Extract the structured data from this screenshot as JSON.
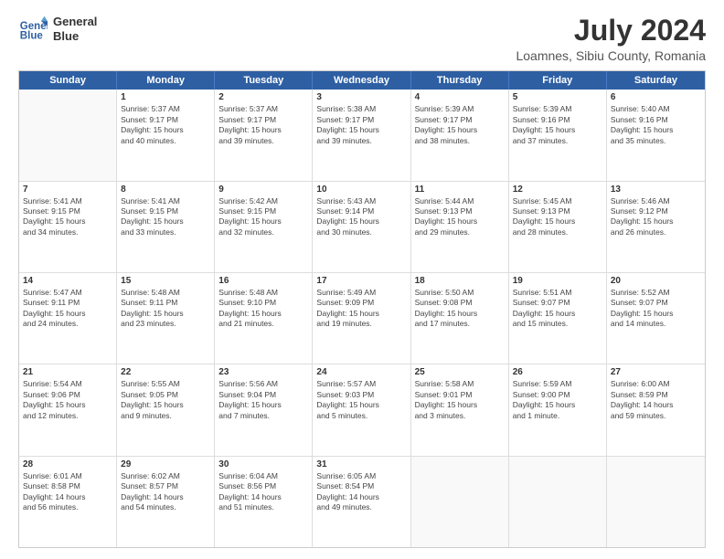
{
  "header": {
    "logo_line1": "General",
    "logo_line2": "Blue",
    "title": "July 2024",
    "subtitle": "Loamnes, Sibiu County, Romania"
  },
  "days_of_week": [
    "Sunday",
    "Monday",
    "Tuesday",
    "Wednesday",
    "Thursday",
    "Friday",
    "Saturday"
  ],
  "weeks": [
    [
      {
        "day": "",
        "lines": []
      },
      {
        "day": "1",
        "lines": [
          "Sunrise: 5:37 AM",
          "Sunset: 9:17 PM",
          "Daylight: 15 hours",
          "and 40 minutes."
        ]
      },
      {
        "day": "2",
        "lines": [
          "Sunrise: 5:37 AM",
          "Sunset: 9:17 PM",
          "Daylight: 15 hours",
          "and 39 minutes."
        ]
      },
      {
        "day": "3",
        "lines": [
          "Sunrise: 5:38 AM",
          "Sunset: 9:17 PM",
          "Daylight: 15 hours",
          "and 39 minutes."
        ]
      },
      {
        "day": "4",
        "lines": [
          "Sunrise: 5:39 AM",
          "Sunset: 9:17 PM",
          "Daylight: 15 hours",
          "and 38 minutes."
        ]
      },
      {
        "day": "5",
        "lines": [
          "Sunrise: 5:39 AM",
          "Sunset: 9:16 PM",
          "Daylight: 15 hours",
          "and 37 minutes."
        ]
      },
      {
        "day": "6",
        "lines": [
          "Sunrise: 5:40 AM",
          "Sunset: 9:16 PM",
          "Daylight: 15 hours",
          "and 35 minutes."
        ]
      }
    ],
    [
      {
        "day": "7",
        "lines": [
          "Sunrise: 5:41 AM",
          "Sunset: 9:15 PM",
          "Daylight: 15 hours",
          "and 34 minutes."
        ]
      },
      {
        "day": "8",
        "lines": [
          "Sunrise: 5:41 AM",
          "Sunset: 9:15 PM",
          "Daylight: 15 hours",
          "and 33 minutes."
        ]
      },
      {
        "day": "9",
        "lines": [
          "Sunrise: 5:42 AM",
          "Sunset: 9:15 PM",
          "Daylight: 15 hours",
          "and 32 minutes."
        ]
      },
      {
        "day": "10",
        "lines": [
          "Sunrise: 5:43 AM",
          "Sunset: 9:14 PM",
          "Daylight: 15 hours",
          "and 30 minutes."
        ]
      },
      {
        "day": "11",
        "lines": [
          "Sunrise: 5:44 AM",
          "Sunset: 9:13 PM",
          "Daylight: 15 hours",
          "and 29 minutes."
        ]
      },
      {
        "day": "12",
        "lines": [
          "Sunrise: 5:45 AM",
          "Sunset: 9:13 PM",
          "Daylight: 15 hours",
          "and 28 minutes."
        ]
      },
      {
        "day": "13",
        "lines": [
          "Sunrise: 5:46 AM",
          "Sunset: 9:12 PM",
          "Daylight: 15 hours",
          "and 26 minutes."
        ]
      }
    ],
    [
      {
        "day": "14",
        "lines": [
          "Sunrise: 5:47 AM",
          "Sunset: 9:11 PM",
          "Daylight: 15 hours",
          "and 24 minutes."
        ]
      },
      {
        "day": "15",
        "lines": [
          "Sunrise: 5:48 AM",
          "Sunset: 9:11 PM",
          "Daylight: 15 hours",
          "and 23 minutes."
        ]
      },
      {
        "day": "16",
        "lines": [
          "Sunrise: 5:48 AM",
          "Sunset: 9:10 PM",
          "Daylight: 15 hours",
          "and 21 minutes."
        ]
      },
      {
        "day": "17",
        "lines": [
          "Sunrise: 5:49 AM",
          "Sunset: 9:09 PM",
          "Daylight: 15 hours",
          "and 19 minutes."
        ]
      },
      {
        "day": "18",
        "lines": [
          "Sunrise: 5:50 AM",
          "Sunset: 9:08 PM",
          "Daylight: 15 hours",
          "and 17 minutes."
        ]
      },
      {
        "day": "19",
        "lines": [
          "Sunrise: 5:51 AM",
          "Sunset: 9:07 PM",
          "Daylight: 15 hours",
          "and 15 minutes."
        ]
      },
      {
        "day": "20",
        "lines": [
          "Sunrise: 5:52 AM",
          "Sunset: 9:07 PM",
          "Daylight: 15 hours",
          "and 14 minutes."
        ]
      }
    ],
    [
      {
        "day": "21",
        "lines": [
          "Sunrise: 5:54 AM",
          "Sunset: 9:06 PM",
          "Daylight: 15 hours",
          "and 12 minutes."
        ]
      },
      {
        "day": "22",
        "lines": [
          "Sunrise: 5:55 AM",
          "Sunset: 9:05 PM",
          "Daylight: 15 hours",
          "and 9 minutes."
        ]
      },
      {
        "day": "23",
        "lines": [
          "Sunrise: 5:56 AM",
          "Sunset: 9:04 PM",
          "Daylight: 15 hours",
          "and 7 minutes."
        ]
      },
      {
        "day": "24",
        "lines": [
          "Sunrise: 5:57 AM",
          "Sunset: 9:03 PM",
          "Daylight: 15 hours",
          "and 5 minutes."
        ]
      },
      {
        "day": "25",
        "lines": [
          "Sunrise: 5:58 AM",
          "Sunset: 9:01 PM",
          "Daylight: 15 hours",
          "and 3 minutes."
        ]
      },
      {
        "day": "26",
        "lines": [
          "Sunrise: 5:59 AM",
          "Sunset: 9:00 PM",
          "Daylight: 15 hours",
          "and 1 minute."
        ]
      },
      {
        "day": "27",
        "lines": [
          "Sunrise: 6:00 AM",
          "Sunset: 8:59 PM",
          "Daylight: 14 hours",
          "and 59 minutes."
        ]
      }
    ],
    [
      {
        "day": "28",
        "lines": [
          "Sunrise: 6:01 AM",
          "Sunset: 8:58 PM",
          "Daylight: 14 hours",
          "and 56 minutes."
        ]
      },
      {
        "day": "29",
        "lines": [
          "Sunrise: 6:02 AM",
          "Sunset: 8:57 PM",
          "Daylight: 14 hours",
          "and 54 minutes."
        ]
      },
      {
        "day": "30",
        "lines": [
          "Sunrise: 6:04 AM",
          "Sunset: 8:56 PM",
          "Daylight: 14 hours",
          "and 51 minutes."
        ]
      },
      {
        "day": "31",
        "lines": [
          "Sunrise: 6:05 AM",
          "Sunset: 8:54 PM",
          "Daylight: 14 hours",
          "and 49 minutes."
        ]
      },
      {
        "day": "",
        "lines": []
      },
      {
        "day": "",
        "lines": []
      },
      {
        "day": "",
        "lines": []
      }
    ]
  ]
}
